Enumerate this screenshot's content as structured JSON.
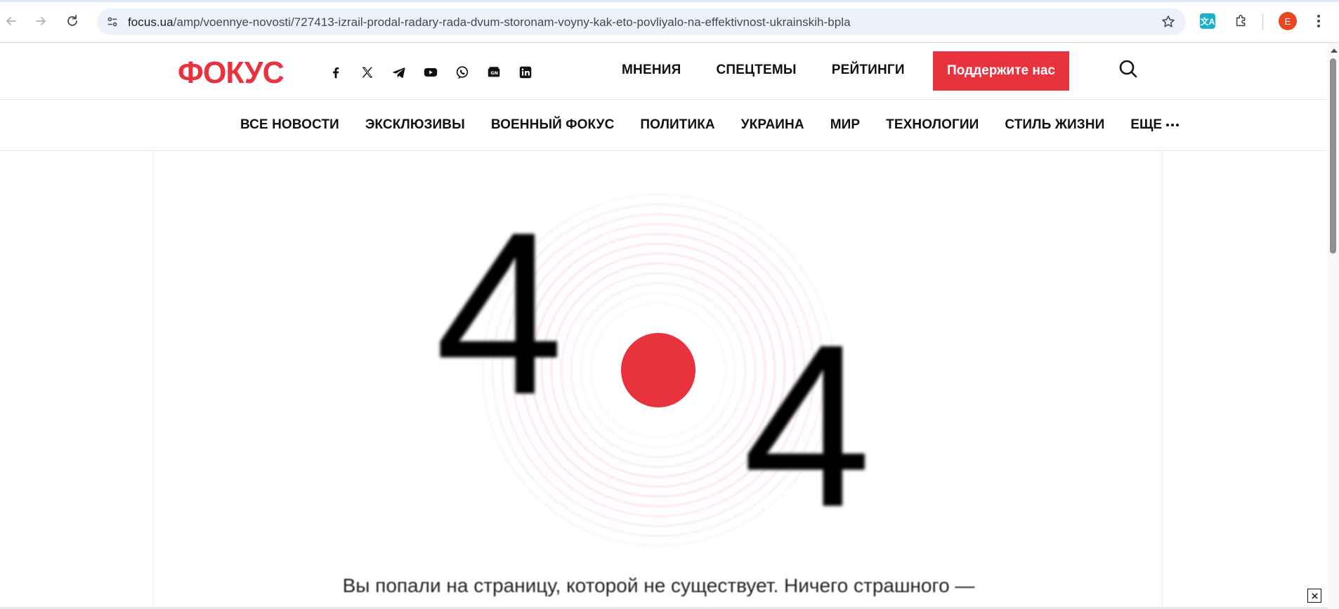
{
  "browser": {
    "url_domain": "focus.ua",
    "url_path": "/amp/voennye-novosti/727413-izrail-prodal-radary-rada-dvum-storonam-voyny-kak-eto-povliyalo-na-effektivnost-ukrainskih-bpla",
    "profile_initial": "E",
    "translate_glyph": "文A"
  },
  "header": {
    "logo": "ФОКУС",
    "social_icons": [
      "facebook-icon",
      "x-icon",
      "telegram-icon",
      "youtube-icon",
      "viber-icon",
      "google-news-icon",
      "linkedin-icon"
    ],
    "top_links": [
      "МНЕНИЯ",
      "СПЕЦТЕМЫ",
      "РЕЙТИНГИ"
    ],
    "support_label": "Поддержите нас"
  },
  "section_nav": {
    "items": [
      "ВСЕ НОВОСТИ",
      "ЭКСКЛЮЗИВЫ",
      "ВОЕННЫЙ ФОКУС",
      "ПОЛИТИКА",
      "УКРАИНА",
      "МИР",
      "ТЕХНОЛОГИИ",
      "СТИЛЬ ЖИЗНИ"
    ],
    "more_label": "ЕЩЕ"
  },
  "error": {
    "digit_left": "4",
    "digit_right": "4",
    "message": "Вы попали на страницу, которой не существует. Ничего страшного —"
  },
  "colors": {
    "brand_red": "#e8323d",
    "chrome_omnibox": "#edf2fa",
    "avatar": "#e8471f"
  }
}
